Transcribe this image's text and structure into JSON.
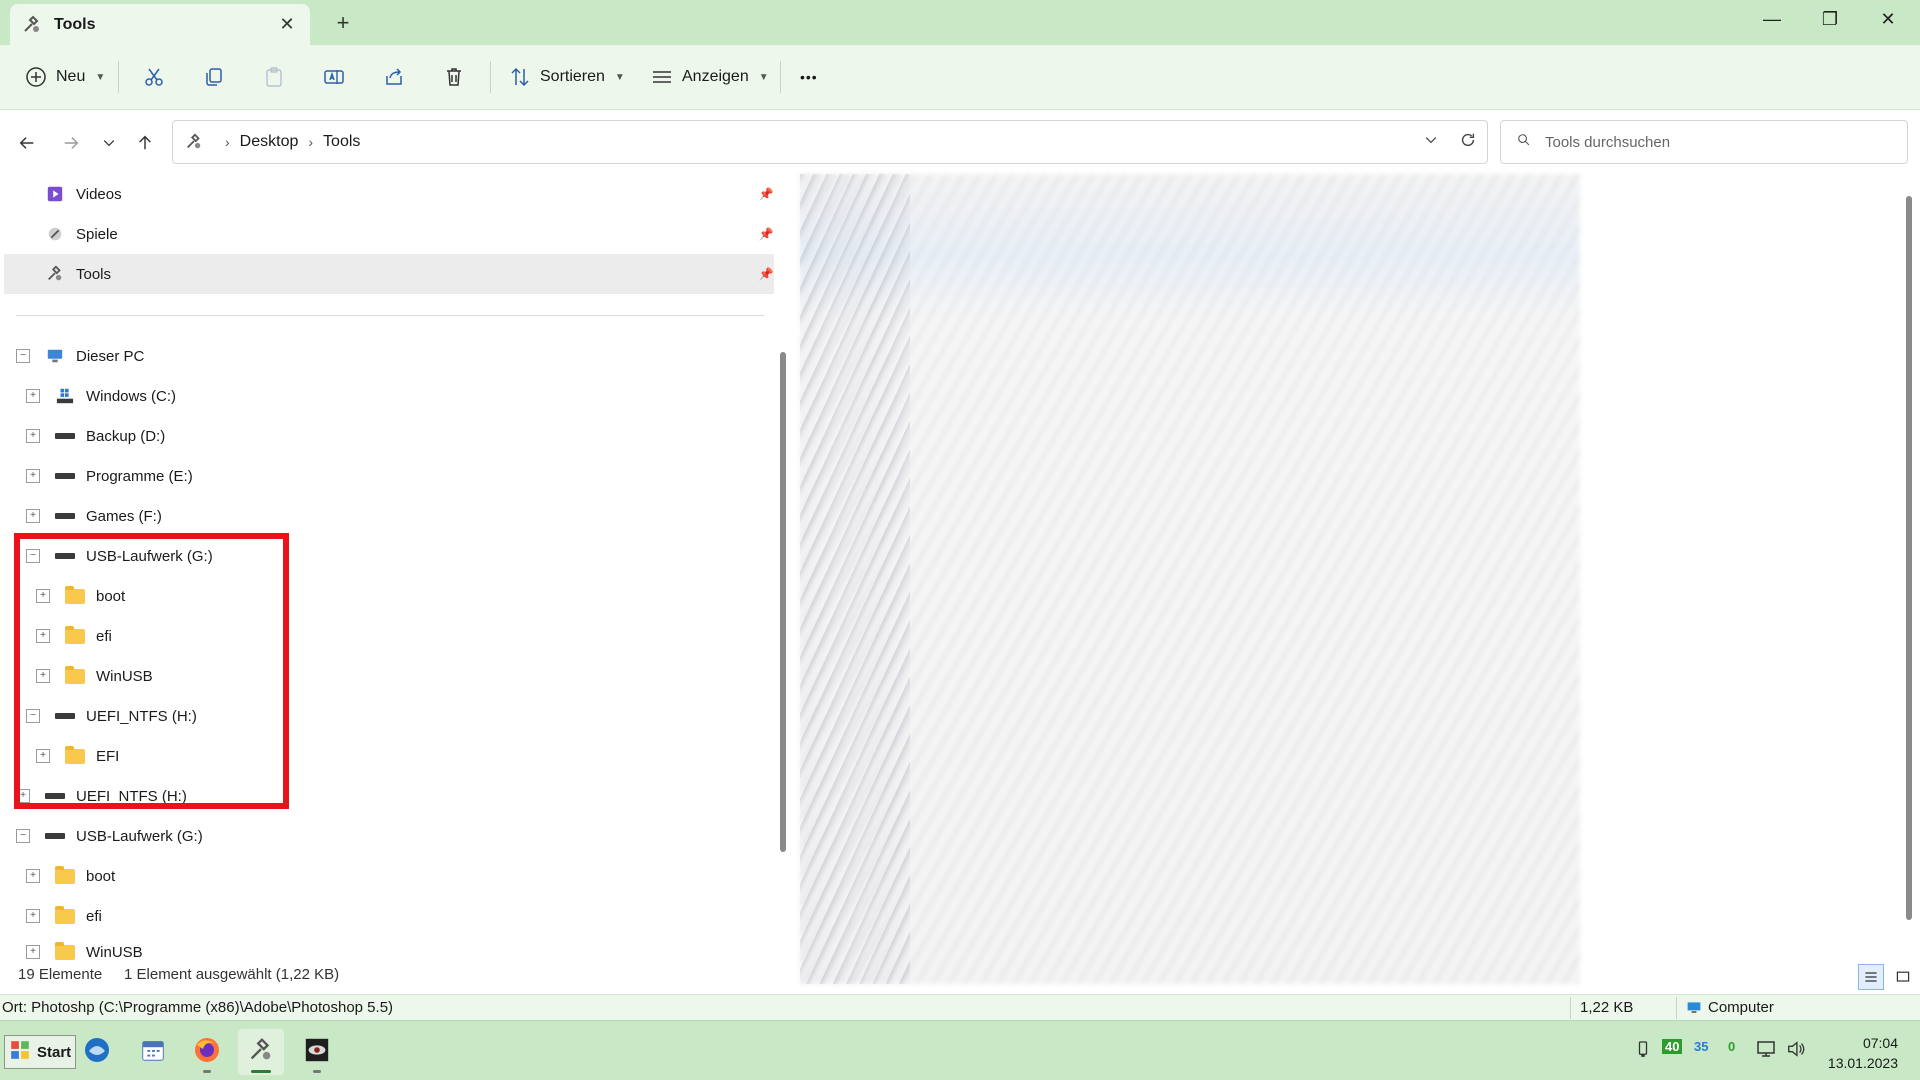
{
  "window": {
    "tab_title": "Tools",
    "tab_close": "✕",
    "new_tab": "+",
    "minimize": "—",
    "maximize": "❐",
    "close": "✕"
  },
  "toolbar": {
    "new_label": "Neu",
    "sort_label": "Sortieren",
    "view_label": "Anzeigen",
    "more_label": "•••"
  },
  "address": {
    "crumbs": [
      "Desktop",
      "Tools"
    ],
    "search_placeholder": "Tools durchsuchen"
  },
  "nav": {
    "pinned": [
      {
        "label": "Videos"
      },
      {
        "label": "Spiele"
      },
      {
        "label": "Tools"
      }
    ],
    "tree": [
      {
        "label": "Dieser PC",
        "expander": "−"
      },
      {
        "label": "Windows (C:)",
        "expander": "+"
      },
      {
        "label": "Backup (D:)",
        "expander": "+"
      },
      {
        "label": "Programme (E:)",
        "expander": "+"
      },
      {
        "label": "Games (F:)",
        "expander": "+"
      },
      {
        "label": "USB-Laufwerk (G:)",
        "expander": "−"
      },
      {
        "label": "boot",
        "expander": "+"
      },
      {
        "label": "efi",
        "expander": "+"
      },
      {
        "label": "WinUSB",
        "expander": "+"
      },
      {
        "label": "UEFI_NTFS (H:)",
        "expander": "−"
      },
      {
        "label": "EFI",
        "expander": "+"
      },
      {
        "label": "UEFI_NTFS (H:)",
        "expander": "+"
      },
      {
        "label": "USB-Laufwerk (G:)",
        "expander": "−"
      },
      {
        "label": "boot",
        "expander": "+"
      },
      {
        "label": "efi",
        "expander": "+"
      },
      {
        "label": "WinUSB",
        "expander": "+"
      }
    ]
  },
  "status": {
    "item_count": "19 Elemente",
    "selection": "1 Element ausgewählt (1,22 KB)",
    "location": "Ort: Photoshp (C:\\Programme (x86)\\Adobe\\Photoshop 5.5)",
    "size": "1,22 KB",
    "zone": "Computer"
  },
  "taskbar": {
    "start_label": "Start",
    "tray_num1": "40",
    "tray_num2": "35",
    "tray_num3": "0",
    "time": "07:04",
    "date": "13.01.2023"
  },
  "colors": {
    "accent_green": "#c9e9c6",
    "highlight_red": "#e8131b",
    "folder_yellow": "#f8c94b"
  }
}
